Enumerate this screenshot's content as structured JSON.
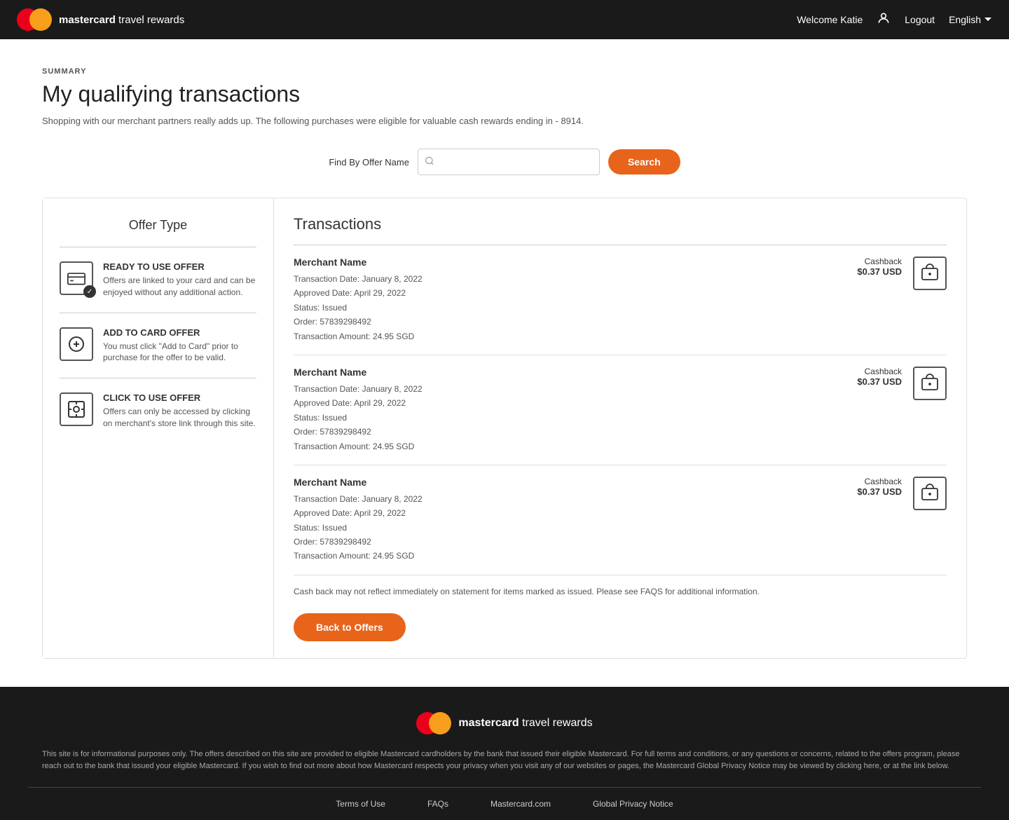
{
  "header": {
    "brand_bold": "mastercard",
    "brand_light": " travel rewards",
    "welcome": "Welcome Katie",
    "logout": "Logout",
    "language": "English"
  },
  "summary": {
    "breadcrumb": "SUMMARY",
    "title": "My qualifying transactions",
    "subtitle": "Shopping with our merchant partners really adds up. The following purchases were eligible for valuable cash rewards ending in - 8914."
  },
  "search": {
    "label": "Find By Offer Name",
    "placeholder": "",
    "button": "Search"
  },
  "offer_type": {
    "title": "Offer Type",
    "items": [
      {
        "name": "READY TO USE OFFER",
        "desc": "Offers are linked to your card and can be enjoyed without any additional action.",
        "type": "ready"
      },
      {
        "name": "ADD TO CARD OFFER",
        "desc": "You must click \"Add to Card\" prior to purchase for the offer to be valid.",
        "type": "add"
      },
      {
        "name": "CLICK TO USE OFFER",
        "desc": "Offers can only be accessed by clicking on merchant's store link through this site.",
        "type": "click"
      }
    ]
  },
  "transactions": {
    "title": "Transactions",
    "rows": [
      {
        "merchant": "Merchant Name",
        "transaction_date": "Transaction Date: January 8, 2022",
        "approved_date": "Approved Date: April 29, 2022",
        "status": "Status: Issued",
        "order": "Order: 57839298492",
        "amount": "Transaction Amount: 24.95 SGD",
        "cashback_label": "Cashback",
        "cashback_amount": "$0.37 USD"
      },
      {
        "merchant": "Merchant Name",
        "transaction_date": "Transaction Date: January 8, 2022",
        "approved_date": "Approved Date: April 29, 2022",
        "status": "Status: Issued",
        "order": "Order: 57839298492",
        "amount": "Transaction Amount: 24.95 SGD",
        "cashback_label": "Cashback",
        "cashback_amount": "$0.37 USD"
      },
      {
        "merchant": "Merchant Name",
        "transaction_date": "Transaction Date: January 8, 2022",
        "approved_date": "Approved Date: April 29, 2022",
        "status": "Status: Issued",
        "order": "Order: 57839298492",
        "amount": "Transaction Amount: 24.95 SGD",
        "cashback_label": "Cashback",
        "cashback_amount": "$0.37 USD"
      }
    ],
    "cashback_note": "Cash back may not reflect immediately on statement for items marked as issued. Please see FAQS for additional information.",
    "back_button": "Back to Offers"
  },
  "footer": {
    "brand_bold": "mastercard",
    "brand_light": " travel rewards",
    "disclaimer": "This site is for informational purposes only. The offers described on this site are provided to eligible Mastercard cardholders by the bank that issued their eligible Mastercard. For full terms and conditions, or any questions or concerns, related to the offers program, please reach out to the bank that issued your eligible Mastercard. If you wish to find out more about how Mastercard respects your privacy when you visit any of our websites or pages, the Mastercard Global Privacy Notice may be viewed by clicking here, or at the link below.",
    "links": [
      {
        "label": "Terms of Use",
        "href": "#"
      },
      {
        "label": "FAQs",
        "href": "#"
      },
      {
        "label": "Mastercard.com",
        "href": "#"
      },
      {
        "label": "Global Privacy Notice",
        "href": "#"
      }
    ]
  }
}
